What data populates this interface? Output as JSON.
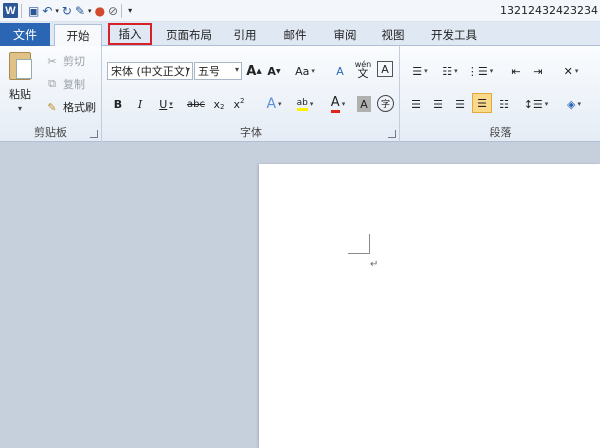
{
  "window": {
    "title": "13212432423234"
  },
  "tabs": {
    "file": "文件",
    "home": "开始",
    "insert": "插入",
    "page_layout": "页面布局",
    "references": "引用",
    "mailings": "邮件",
    "review": "审阅",
    "view": "视图",
    "developer": "开发工具"
  },
  "clipboard": {
    "paste": "粘贴",
    "cut": "剪切",
    "copy": "复制",
    "format_painter": "格式刷",
    "label": "剪贴板"
  },
  "font": {
    "face": "宋体 (中文正文)",
    "size": "五号",
    "grow": "A",
    "shrink": "A",
    "change_case": "Aa",
    "clear_format": "A",
    "phonetic": "wén",
    "enclose": "A",
    "bold": "B",
    "italic": "I",
    "underline": "U",
    "strike": "abc",
    "subscript": "x",
    "superscript": "x",
    "text_effect": "A",
    "highlight": "ab",
    "font_color": "A",
    "char_shading": "A",
    "enclose_char": "字",
    "label": "字体"
  },
  "paragraph": {
    "label": "段落"
  },
  "colors": {
    "accent": "#2a66b3",
    "highlight_border": "#d6202a"
  }
}
